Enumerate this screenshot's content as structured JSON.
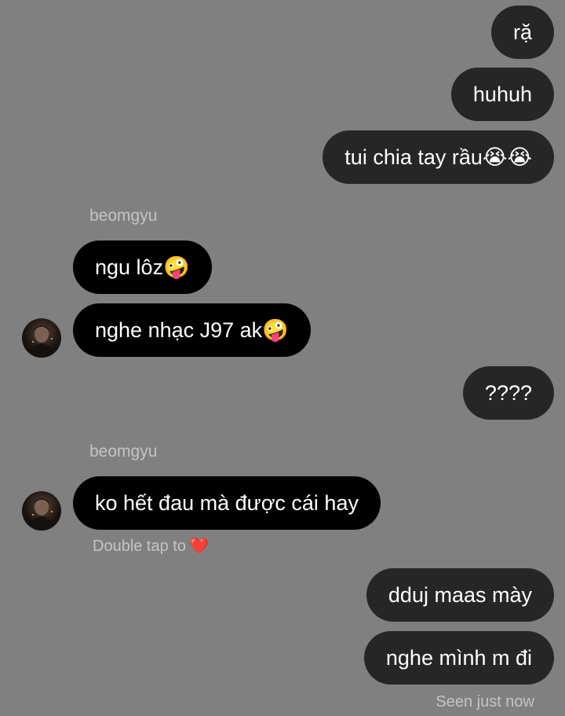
{
  "conversation": {
    "messages": [
      {
        "direction": "sent",
        "text": "rặ"
      },
      {
        "direction": "sent",
        "text": "huhuh"
      },
      {
        "direction": "sent",
        "text": "tui chia tay rầu😭😭"
      },
      {
        "direction": "received",
        "sender": "beomgyu",
        "text": "ngu lôz🤪"
      },
      {
        "direction": "received",
        "text": "nghe nhạc J97 ak🤪"
      },
      {
        "direction": "sent",
        "text": "????"
      },
      {
        "direction": "received",
        "sender": "beomgyu",
        "text": "ko hết đau mà được cái hay"
      },
      {
        "direction": "sent",
        "text": "dduj maas mày"
      },
      {
        "direction": "sent",
        "text": "nghe mình m đi"
      }
    ],
    "reaction_hint": "Double tap to",
    "reaction_hint_icon": "❤️",
    "seen_status": "Seen just now"
  },
  "colors": {
    "background": "#808080",
    "sent_bubble": "#262626",
    "received_bubble": "#000000",
    "meta_text": "#c4c4c4"
  }
}
